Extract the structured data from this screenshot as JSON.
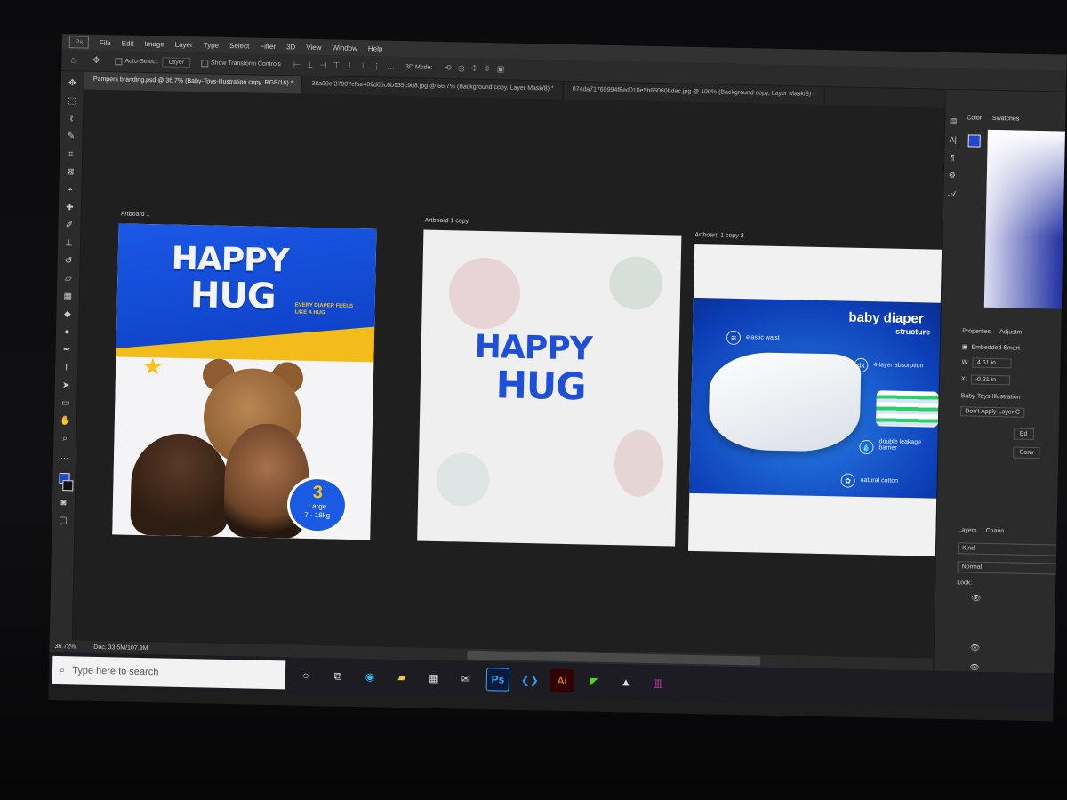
{
  "menubar": {
    "items": [
      "File",
      "Edit",
      "Image",
      "Layer",
      "Type",
      "Select",
      "Filter",
      "3D",
      "View",
      "Window",
      "Help"
    ]
  },
  "options": {
    "auto_select_label": "Auto-Select:",
    "auto_select_value": "Layer",
    "show_transform_label": "Show Transform Controls",
    "mode_3d": "3D Mode:"
  },
  "tabs": [
    "Pampers branding.psd @ 36.7% (Baby-Toys-Illustration copy, RGB/16) *",
    "38a99ef27007cfae409d65c0b935c9d8.jpg @ 66.7% (Background copy, Layer Mask/8) *",
    "074da71769994f8ed010e5b65060bdec.jpg @ 100% (Background copy, Layer Mask/8) *"
  ],
  "artboards": {
    "ab1": {
      "label": "Artboard 1",
      "logo_happy": "HAPPY",
      "logo_hug": "HUG",
      "tagline": "EVERY DIAPER FEELS LIKE A HUG",
      "size_number": "3",
      "size_name": "Large",
      "size_weight": "7 - 18kg"
    },
    "ab2": {
      "label": "Artboard 1 copy",
      "logo_happy": "HAPPY",
      "logo_hug": "HUG"
    },
    "ab3": {
      "label": "Artboard 1 copy 2",
      "title": "baby diaper",
      "subtitle": "structure",
      "features": [
        "elastic waist",
        "4-layer absorption",
        "double leakage barrier",
        "natural cotton"
      ]
    }
  },
  "status": {
    "zoom": "36.72%",
    "doc": "Doc: 33.5M/107.9M"
  },
  "panels": {
    "color_tab": "Color",
    "swatches_tab": "Swatches",
    "properties_tab": "Properties",
    "adjustments_tab": "Adjustm",
    "embedded": "Embedded Smart",
    "w_label": "W:",
    "w_value": "4.61 in",
    "x_label": "X:",
    "x_value": "-0.21 in",
    "layer_name": "Baby-Toys-Illustration",
    "dont_apply": "Don't Apply Layer C",
    "edit_btn": "Ed",
    "convert_btn": "Conv",
    "layers_tab": "Layers",
    "channels_tab": "Chann",
    "kind": "Kind",
    "blend": "Normal",
    "lock": "Lock:"
  },
  "taskbar": {
    "search_placeholder": "Type here to search",
    "ps": "Ps",
    "ai": "Ai"
  },
  "colors": {
    "brand_blue": "#1d4fd8",
    "brand_yellow": "#f2bc1b",
    "ps_accent": "#31a8ff"
  }
}
